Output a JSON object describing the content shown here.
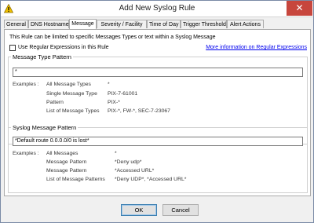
{
  "window": {
    "title": "Add New Syslog Rule",
    "close_glyph": "✕"
  },
  "tabs": [
    {
      "label": "General"
    },
    {
      "label": "DNS Hostname"
    },
    {
      "label": "Message"
    },
    {
      "label": "Severity / Facility"
    },
    {
      "label": "Time of Day"
    },
    {
      "label": "Trigger Threshold"
    },
    {
      "label": "Alert Actions"
    }
  ],
  "message_tab": {
    "intro": "This Rule can be limited to specific Messages Types or text within a Syslog Message",
    "regex_checkbox_label": "Use Regular Expressions in this Rule",
    "regex_checked": false,
    "regex_link": "More information on Regular Expressions",
    "type_pattern": {
      "label": "Message Type Pattern",
      "value": "*",
      "examples_label": "Examples :",
      "examples": [
        {
          "desc": "All Message Types",
          "value": "*"
        },
        {
          "desc": "Single Message Type",
          "value": "PIX-7-61001"
        },
        {
          "desc": "Pattern",
          "value": "PIX-*"
        },
        {
          "desc": "List of Message Types",
          "value": "PIX-*, FW-*, SEC-7-23067"
        }
      ]
    },
    "syslog_pattern": {
      "label": "Syslog Message Pattern",
      "value": "*Default route 0.0.0.0/0 is lost*",
      "examples_label": "Examples :",
      "examples": [
        {
          "desc": "All Messages",
          "value": "*"
        },
        {
          "desc": "Message Pattern",
          "value": "*Deny udp*"
        },
        {
          "desc": "Message Pattern",
          "value": "*Accessed URL*"
        },
        {
          "desc": "List of Message Patterns",
          "value": "*Deny UDP*, *Accessed URL*"
        }
      ]
    }
  },
  "buttons": {
    "ok": "OK",
    "cancel": "Cancel"
  },
  "colors": {
    "close": "#c7463d",
    "link": "#0000ee",
    "icon": "#f2c200"
  }
}
